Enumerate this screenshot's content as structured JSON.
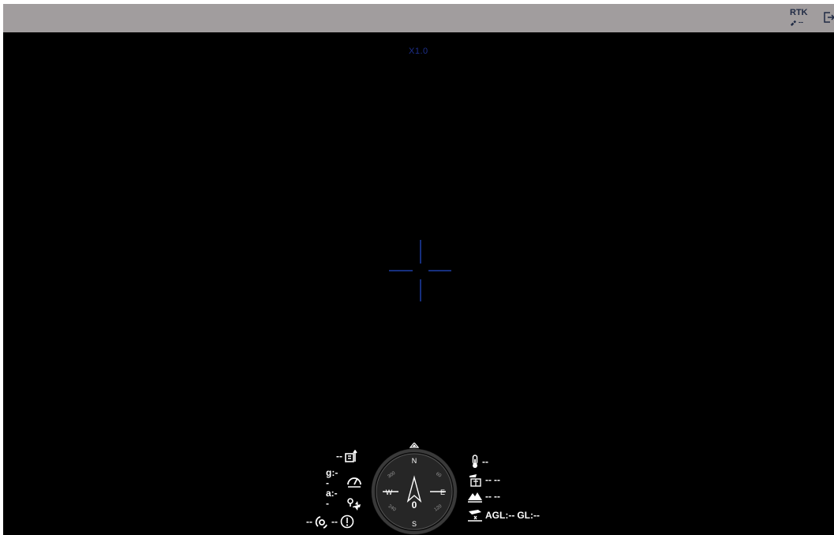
{
  "topbar": {
    "rtk_label": "RTK",
    "rtk_value": "--"
  },
  "camera": {
    "zoom": "X1.0"
  },
  "telemetry_left": {
    "altitude": "--",
    "speed_g": "g:--",
    "speed_a": "a:--",
    "distance_left": "--",
    "distance_right": "--"
  },
  "compass": {
    "north": "N",
    "south": "S",
    "east": "E",
    "west": "W",
    "deg_300": "300",
    "deg_60": "60",
    "deg_240": "240",
    "deg_120": "120",
    "heading": "0"
  },
  "telemetry_right": {
    "temperature": "--",
    "rate_a": "--",
    "rate_b": "--",
    "terrain_a": "--",
    "terrain_b": "--",
    "agl": "AGL:--",
    "gl": "GL:--"
  },
  "colors": {
    "accent": "#1d3fa8",
    "topbar": "#a19d9e",
    "hud": "#ffffff"
  }
}
